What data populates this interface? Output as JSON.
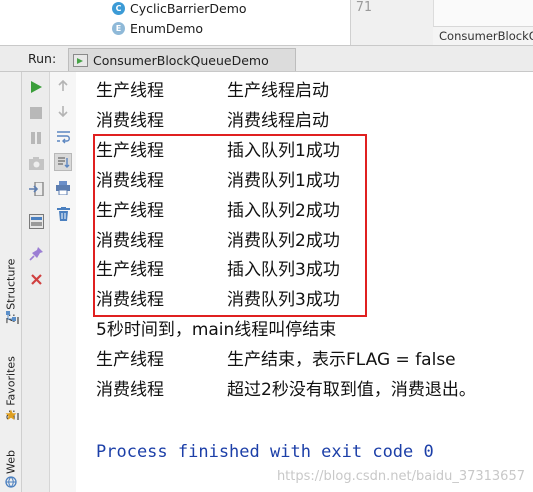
{
  "project_tree": {
    "items": [
      {
        "label": "CyclicBarrierDemo",
        "icon": "class-icon",
        "badge": "C"
      },
      {
        "label": "EnumDemo",
        "icon": "enum-icon",
        "badge": "E"
      }
    ]
  },
  "editor": {
    "line_number": "71",
    "tab_label": "ConsumerBlockQueueDemo"
  },
  "run_panel": {
    "label": "Run:",
    "tab_label": "ConsumerBlockQueueDemo"
  },
  "side_tabs": {
    "structure": {
      "num": "7",
      "label": ": Structure"
    },
    "favorites": {
      "num": "2",
      "label": ": Favorites"
    },
    "web": {
      "label": "Web"
    }
  },
  "console": {
    "lines": [
      {
        "thread": "生产线程",
        "message": "生产线程启动"
      },
      {
        "thread": "消费线程",
        "message": "消费线程启动"
      },
      {
        "thread": "生产线程",
        "message": "插入队列1成功"
      },
      {
        "thread": "消费线程",
        "message": "消费队列1成功"
      },
      {
        "thread": "生产线程",
        "message": "插入队列2成功"
      },
      {
        "thread": "消费线程",
        "message": "消费队列2成功"
      },
      {
        "thread": "生产线程",
        "message": "插入队列3成功"
      },
      {
        "thread": "消费线程",
        "message": "消费队列3成功"
      }
    ],
    "timeout_line": "5秒时间到，main线程叫停结束",
    "end_lines": [
      {
        "thread": "生产线程",
        "message": "生产结束，表示FLAG = false"
      },
      {
        "thread": "消费线程",
        "message": "超过2秒没有取到值，消费退出。"
      }
    ],
    "process_line": "Process finished with exit code 0"
  },
  "watermark": "https://blog.csdn.net/baidu_37313657",
  "colors": {
    "highlight_border": "#e02020",
    "run_green": "#47a347",
    "process_text": "#1c3fa8"
  }
}
